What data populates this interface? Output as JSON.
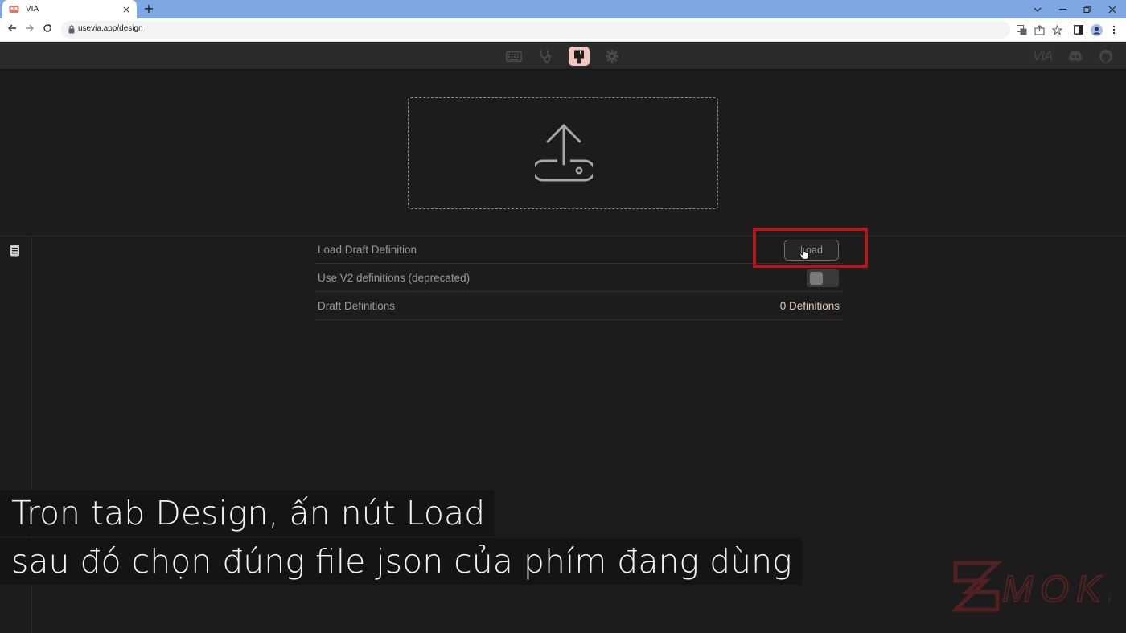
{
  "browser": {
    "tab_title": "VIA",
    "tab_close": "×",
    "new_tab": "+",
    "url": "usevia.app/design"
  },
  "app": {
    "brand_logo": "VIA",
    "nav_icons": [
      "keyboard-icon",
      "stethoscope-icon",
      "paintbrush-icon",
      "gear-icon"
    ],
    "active_nav": "paintbrush-icon",
    "right_icons": [
      "via-logo",
      "discord-icon",
      "github-icon"
    ],
    "accent_color": "#f1c6bd"
  },
  "design": {
    "rows": [
      {
        "label": "Load Draft Definition",
        "button_label": "Load"
      },
      {
        "label": "Use V2 definitions (deprecated)",
        "toggle_on": false
      },
      {
        "label": "Draft Definitions",
        "value": "0 Definitions"
      }
    ]
  },
  "overlay": {
    "highlight_color": "#b3161c",
    "subtitle_line1": "Tron tab Design, ấn nút Load",
    "subtitle_line2": "sau đó chọn đúng file json của phím đang dùng",
    "watermark": "MOKB"
  }
}
